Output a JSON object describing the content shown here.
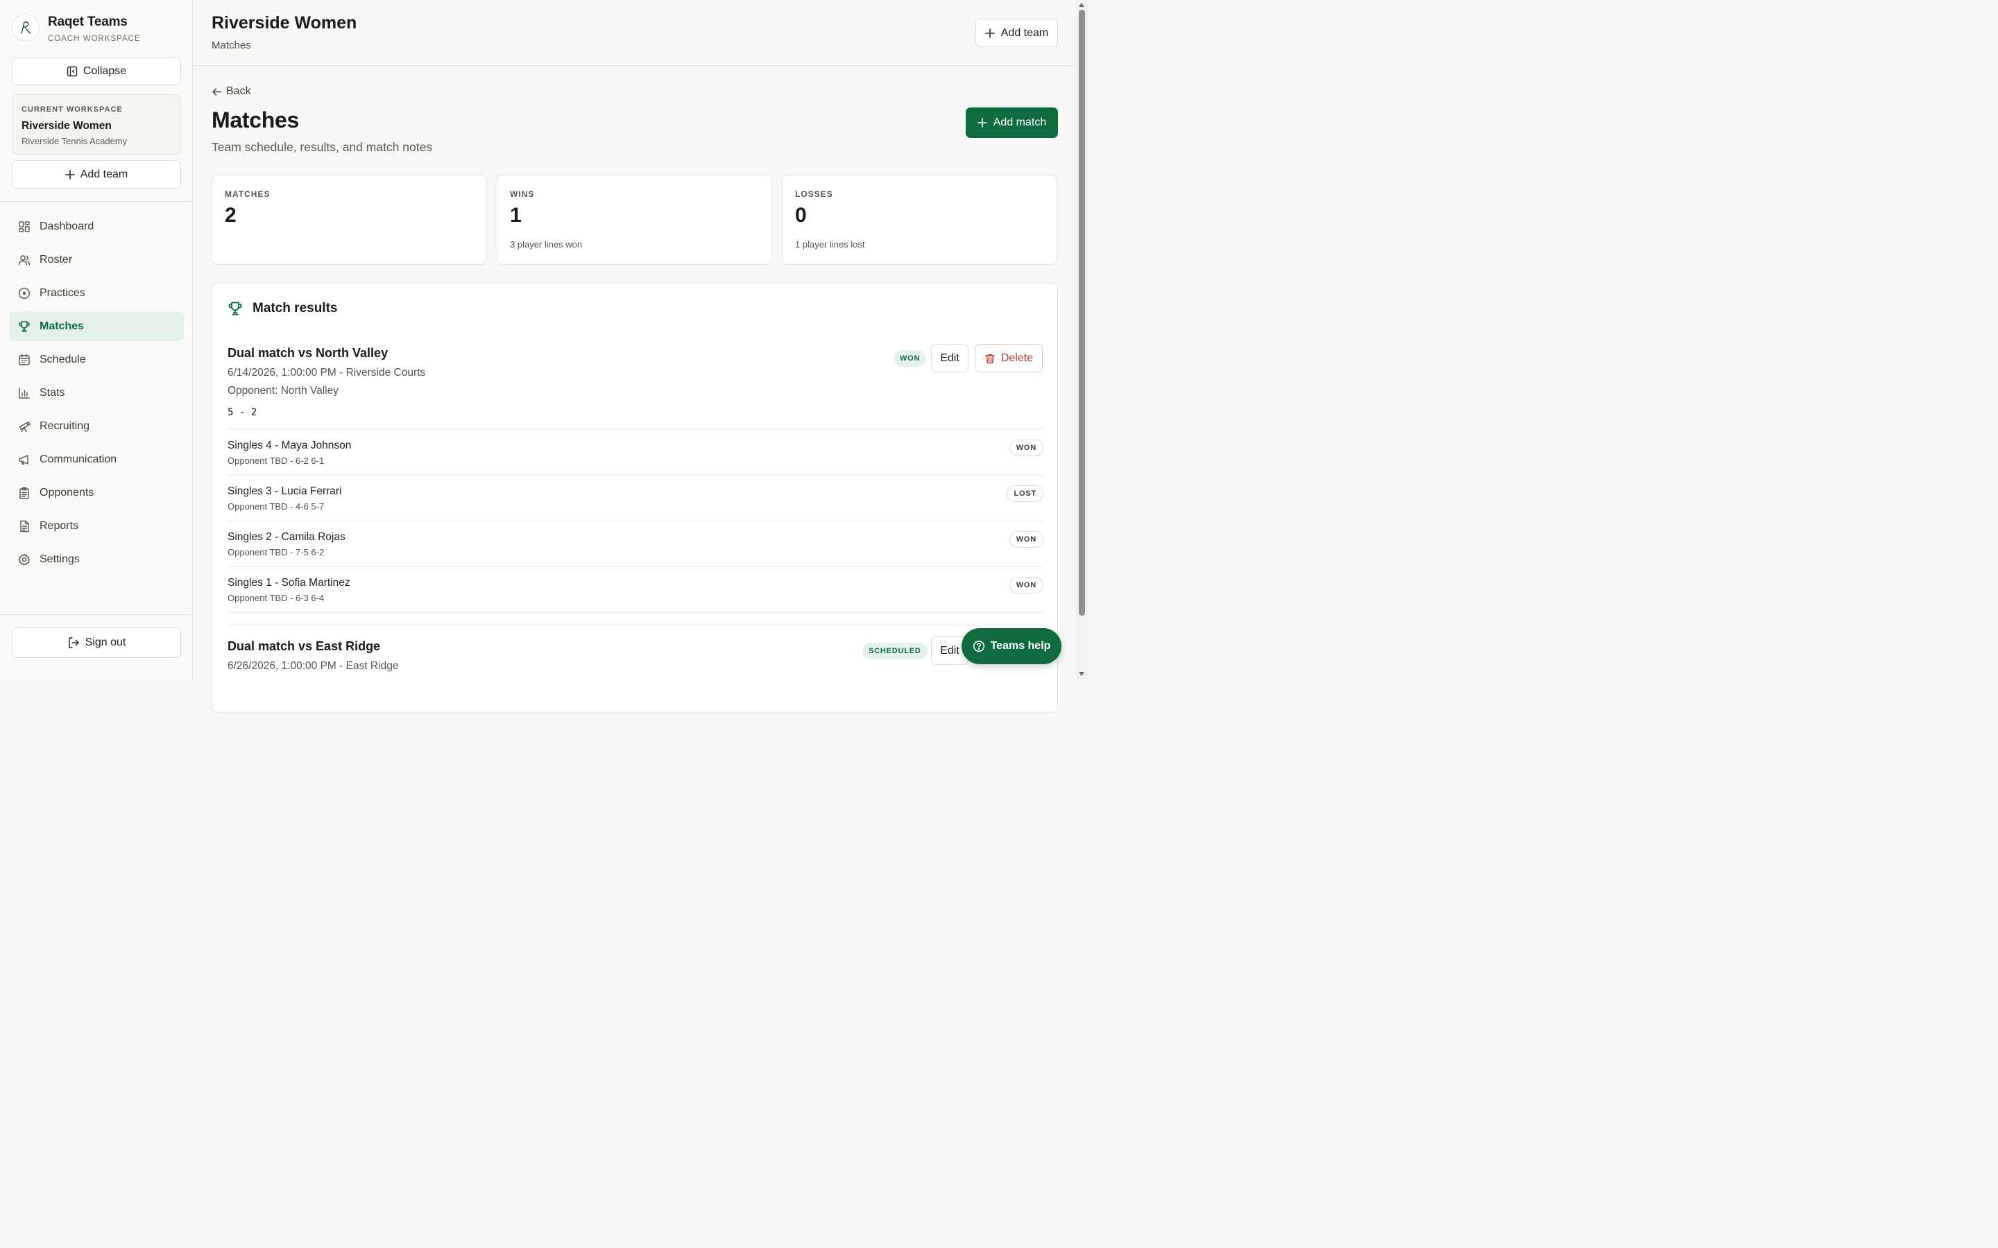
{
  "brand": {
    "title": "Raqet Teams",
    "subtitle": "COACH WORKSPACE"
  },
  "sidebar": {
    "collapse_label": "Collapse",
    "workspace": {
      "label": "CURRENT WORKSPACE",
      "name": "Riverside Women",
      "org": "Riverside Tennis Academy"
    },
    "add_team_label": "Add team",
    "nav": [
      {
        "label": "Dashboard",
        "icon": "dashboard-icon"
      },
      {
        "label": "Roster",
        "icon": "users-icon"
      },
      {
        "label": "Practices",
        "icon": "target-icon"
      },
      {
        "label": "Matches",
        "icon": "trophy-icon",
        "active": true
      },
      {
        "label": "Schedule",
        "icon": "calendar-icon"
      },
      {
        "label": "Stats",
        "icon": "bar-chart-icon"
      },
      {
        "label": "Recruiting",
        "icon": "telescope-icon"
      },
      {
        "label": "Communication",
        "icon": "megaphone-icon"
      },
      {
        "label": "Opponents",
        "icon": "clipboard-icon"
      },
      {
        "label": "Reports",
        "icon": "file-icon"
      },
      {
        "label": "Settings",
        "icon": "gear-icon"
      }
    ],
    "sign_out_label": "Sign out"
  },
  "header": {
    "title": "Riverside Women",
    "subtitle": "Matches",
    "add_team_label": "Add team"
  },
  "main": {
    "back_label": "Back",
    "title": "Matches",
    "subtitle": "Team schedule, results, and match notes",
    "add_match_label": "Add match",
    "stats": [
      {
        "label": "MATCHES",
        "value": "2",
        "note": ""
      },
      {
        "label": "WINS",
        "value": "1",
        "note": "3 player lines won"
      },
      {
        "label": "LOSSES",
        "value": "0",
        "note": "1 player lines lost"
      }
    ],
    "results_title": "Match results",
    "matches": [
      {
        "title": "Dual match vs North Valley",
        "datetime_location": "6/14/2026, 1:00:00 PM - Riverside Courts",
        "opponent": "Opponent: North Valley",
        "score": "5 - 2",
        "status": "WON",
        "edit_label": "Edit",
        "delete_label": "Delete",
        "lines": [
          {
            "name": "Singles 4 - Maya Johnson",
            "detail": "Opponent TBD - 6-2 6-1",
            "result": "WON"
          },
          {
            "name": "Singles 3 - Lucia Ferrari",
            "detail": "Opponent TBD - 4-6 5-7",
            "result": "LOST"
          },
          {
            "name": "Singles 2 - Camila Rojas",
            "detail": "Opponent TBD - 7-5 6-2",
            "result": "WON"
          },
          {
            "name": "Singles 1 - Sofia Martinez",
            "detail": "Opponent TBD - 6-3 6-4",
            "result": "WON"
          }
        ]
      },
      {
        "title": "Dual match vs East Ridge",
        "datetime_location": "6/26/2026, 1:00:00 PM - East Ridge",
        "status": "SCHEDULED",
        "edit_label": "Edit"
      }
    ]
  },
  "help_label": "Teams help",
  "colors": {
    "accent": "#0f6b3f",
    "accent_soft": "#e6f1ea",
    "danger": "#b33b2e"
  }
}
